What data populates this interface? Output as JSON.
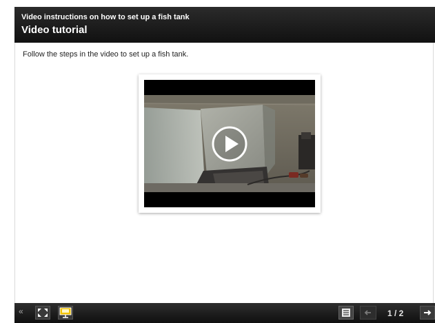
{
  "header": {
    "lesson_title": "Video instructions on how to set up a fish tank",
    "page_title": "Video tutorial"
  },
  "content": {
    "instructions": "Follow the steps in the video to set up a fish tank."
  },
  "video": {
    "play_icon": "play-icon"
  },
  "toolbar": {
    "collapse_icon": "double-chevron-left-icon",
    "fullscreen_icon": "fullscreen-icon",
    "presenter_icon": "presenter-icon",
    "menu_icon": "menu-list-icon",
    "prev_icon": "arrow-left-icon",
    "next_icon": "arrow-right-icon",
    "page_counter": "1 / 2"
  },
  "colors": {
    "header_bg": "#111111",
    "toolbar_bg": "#1a1a1a",
    "presenter_accent": "#f2c200"
  }
}
